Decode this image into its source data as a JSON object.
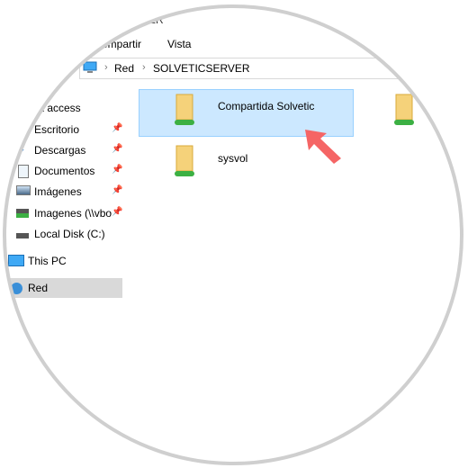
{
  "window": {
    "title_fragment": "ER"
  },
  "ribbon": {
    "tabs": [
      {
        "label": "ompartir"
      },
      {
        "label": "Vista"
      }
    ]
  },
  "address_bar": {
    "icon": "computer-icon",
    "path": [
      "Red",
      "SOLVETICSERVER"
    ]
  },
  "sidebar": {
    "quick_access": "ck access",
    "items": [
      {
        "label": "Escritorio",
        "icon": "desktop-icon",
        "pinned": true
      },
      {
        "label": "Descargas",
        "icon": "download-icon",
        "pinned": true
      },
      {
        "label": "Documentos",
        "icon": "documents-icon",
        "pinned": true
      },
      {
        "label": "Imágenes",
        "icon": "pictures-icon",
        "pinned": true
      },
      {
        "label": "Imagenes (\\\\vbo",
        "icon": "network-drive-icon",
        "pinned": true
      },
      {
        "label": "Local Disk (C:)",
        "icon": "disk-icon",
        "pinned": false
      }
    ],
    "this_pc": "This PC",
    "network": "Red"
  },
  "content": {
    "items": [
      {
        "label": "Compartida Solvetic",
        "icon": "shared-folder-icon",
        "selected": true
      },
      {
        "label": "sysvol",
        "icon": "shared-folder-icon",
        "selected": false
      },
      {
        "label": "",
        "icon": "shared-folder-icon",
        "selected": false
      }
    ]
  },
  "annotation": {
    "arrow_color": "#f56565"
  },
  "colors": {
    "selection": "#cce8ff",
    "nav_selected": "#d9d9d9"
  }
}
